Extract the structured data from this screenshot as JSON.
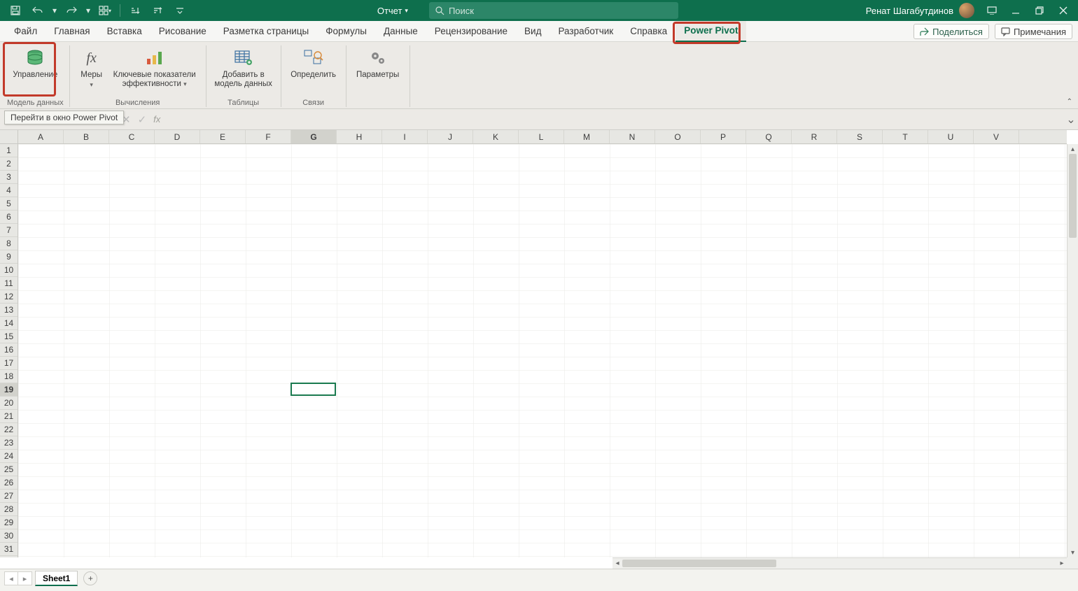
{
  "titlebar": {
    "doc_name": "Отчет",
    "search_placeholder": "Поиск",
    "user_name": "Ренат Шагабутдинов"
  },
  "tabs": {
    "file": "Файл",
    "home": "Главная",
    "insert": "Вставка",
    "draw": "Рисование",
    "page_layout": "Разметка страницы",
    "formulas": "Формулы",
    "data": "Данные",
    "review": "Рецензирование",
    "view": "Вид",
    "developer": "Разработчик",
    "help": "Справка",
    "power_pivot": "Power Pivot",
    "share": "Поделиться",
    "comments": "Примечания"
  },
  "ribbon": {
    "manage": "Управление",
    "measures": "Меры",
    "kpi": "Ключевые показатели эффективности",
    "add_to_model_l1": "Добавить в",
    "add_to_model_l2": "модель данных",
    "detect": "Определить",
    "settings": "Параметры",
    "group_model": "Модель данных",
    "group_calc": "Вычисления",
    "group_tables": "Таблицы",
    "group_relations": "Связи"
  },
  "tooltip": "Перейти в окно Power Pivot",
  "sheet": {
    "columns": [
      "A",
      "B",
      "C",
      "D",
      "E",
      "F",
      "G",
      "H",
      "I",
      "J",
      "K",
      "L",
      "M",
      "N",
      "O",
      "P",
      "Q",
      "R",
      "S",
      "T",
      "U",
      "V"
    ],
    "row_count": 31,
    "active_col_index": 6,
    "active_row_index": 18,
    "tab1": "Sheet1"
  }
}
